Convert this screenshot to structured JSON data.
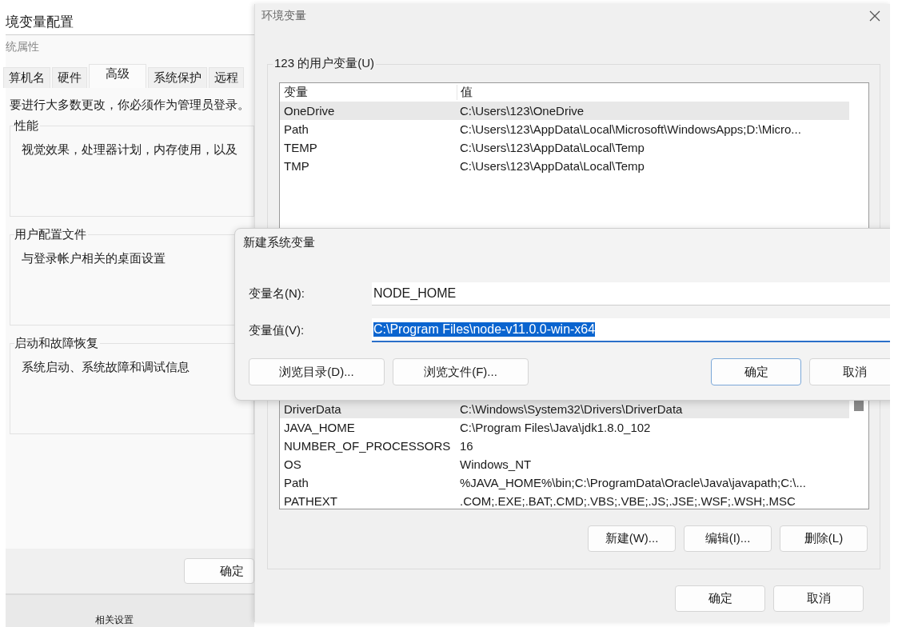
{
  "back_window": {
    "title": "境变量配置",
    "subtitle": "统属性",
    "tabs": [
      {
        "label": "算机名",
        "selected": false
      },
      {
        "label": "硬件",
        "selected": false
      },
      {
        "label": "高级",
        "selected": true
      },
      {
        "label": "系统保护",
        "selected": false
      },
      {
        "label": "远程",
        "selected": false
      }
    ],
    "notice": "要进行大多数更改，你必须作为管理员登录。",
    "groups": [
      {
        "title": "性能",
        "text": "视觉效果，处理器计划，内存使用，以及"
      },
      {
        "title": "用户配置文件",
        "text": "与登录帐户相关的桌面设置"
      },
      {
        "title": "启动和故障恢复",
        "text": "系统启动、系统故障和调试信息"
      }
    ],
    "ok_button": "确定",
    "footer": "相关设置"
  },
  "env_window": {
    "title": "环境变量",
    "user_group": "123 的用户变量(U)",
    "columns": [
      "变量",
      "值"
    ],
    "user_rows": [
      {
        "name": "OneDrive",
        "value": "C:\\Users\\123\\OneDrive",
        "selected": true
      },
      {
        "name": "Path",
        "value": "C:\\Users\\123\\AppData\\Local\\Microsoft\\WindowsApps;D:\\Micro...",
        "selected": false
      },
      {
        "name": "TEMP",
        "value": "C:\\Users\\123\\AppData\\Local\\Temp",
        "selected": false
      },
      {
        "name": "TMP",
        "value": "C:\\Users\\123\\AppData\\Local\\Temp",
        "selected": false
      }
    ],
    "system_rows": [
      {
        "name": "DriverData",
        "value": "C:\\Windows\\System32\\Drivers\\DriverData",
        "selected": true
      },
      {
        "name": "JAVA_HOME",
        "value": "C:\\Program Files\\Java\\jdk1.8.0_102",
        "selected": false
      },
      {
        "name": "NUMBER_OF_PROCESSORS",
        "value": "16",
        "selected": false
      },
      {
        "name": "OS",
        "value": "Windows_NT",
        "selected": false
      },
      {
        "name": "Path",
        "value": "%JAVA_HOME%\\bin;C:\\ProgramData\\Oracle\\Java\\javapath;C:\\...",
        "selected": false
      },
      {
        "name": "PATHEXT",
        "value": ".COM;.EXE;.BAT;.CMD;.VBS;.VBE;.JS;.JSE;.WSF;.WSH;.MSC",
        "selected": false
      }
    ],
    "system_buttons": [
      "新建(W)...",
      "编辑(I)...",
      "删除(L)"
    ],
    "buttons": [
      "确定",
      "取消"
    ]
  },
  "dialog": {
    "title": "新建系统变量",
    "fields": [
      {
        "label": "变量名(N):",
        "value": "NODE_HOME",
        "text_selected": false
      },
      {
        "label": "变量值(V):",
        "value": "C:\\Program Files\\node-v11.0.0-win-x64",
        "text_selected": true
      }
    ],
    "buttons": [
      {
        "label": "浏览目录(D)...",
        "default": false
      },
      {
        "label": "浏览文件(F)...",
        "default": false
      },
      {
        "label": "确定",
        "default": true
      },
      {
        "label": "取消",
        "default": false
      }
    ]
  }
}
